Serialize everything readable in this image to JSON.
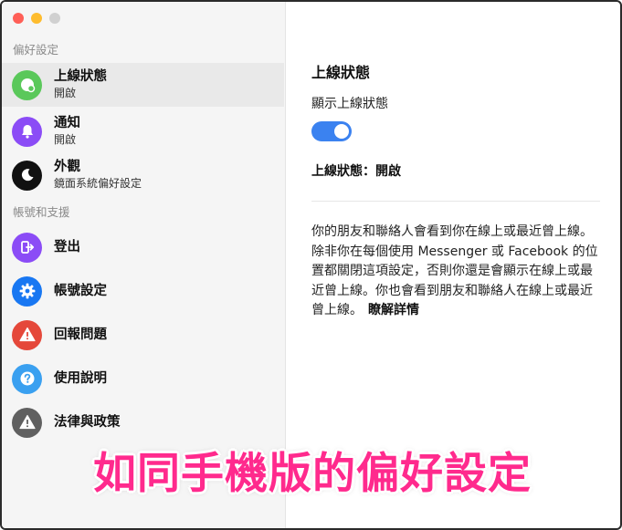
{
  "sidebar": {
    "sections": [
      {
        "header": "偏好設定"
      },
      {
        "header": "帳號和支援"
      }
    ],
    "items": [
      {
        "label": "上線狀態",
        "sub": "開啟",
        "icon": "status-dot-icon",
        "color": "#5ac85a"
      },
      {
        "label": "通知",
        "sub": "開啟",
        "icon": "bell-icon",
        "color": "#8b4cf6"
      },
      {
        "label": "外觀",
        "sub": "鏡面系統偏好設定",
        "icon": "moon-icon",
        "color": "#111111"
      },
      {
        "label": "登出",
        "icon": "logout-icon",
        "color": "#8b4cf6"
      },
      {
        "label": "帳號設定",
        "icon": "gear-icon",
        "color": "#1877f2"
      },
      {
        "label": "回報問題",
        "icon": "warning-icon",
        "color": "#e5483a"
      },
      {
        "label": "使用說明",
        "icon": "help-icon",
        "color": "#3aa0f0"
      },
      {
        "label": "法律與政策",
        "icon": "warning-icon",
        "color": "#606060"
      }
    ]
  },
  "main": {
    "title": "上線狀態",
    "toggle_label": "顯示上線狀態",
    "toggle_on": true,
    "status_line": "上線狀態：開啟",
    "description": "你的朋友和聯絡人會看到你在線上或最近曾上線。除非你在每個使用 Messenger 或 Facebook 的位置都關閉這項設定，否則你還是會顯示在線上或最近曾上線。你也會看到朋友和聯絡人在線上或最近曾上線。",
    "learn_more": "瞭解詳情"
  },
  "overlay_caption": "如同手機版的偏好設定",
  "colors": {
    "accent": "#3b82f0",
    "caption": "#ff2a8d"
  }
}
